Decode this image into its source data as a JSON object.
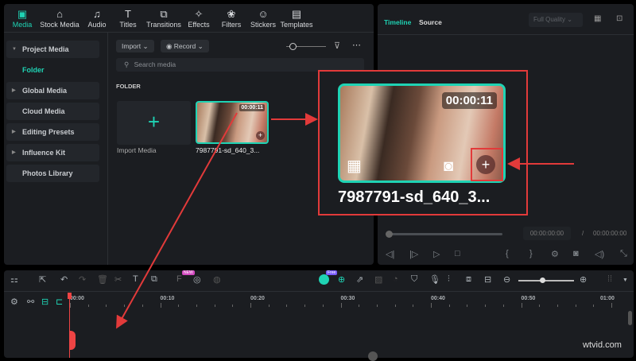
{
  "tabs": [
    {
      "label": "Media",
      "icon": "media-icon",
      "active": true
    },
    {
      "label": "Stock Media",
      "icon": "stock-media-icon"
    },
    {
      "label": "Audio",
      "icon": "music-note-icon"
    },
    {
      "label": "Titles",
      "icon": "text-t-icon"
    },
    {
      "label": "Transitions",
      "icon": "transitions-icon"
    },
    {
      "label": "Effects",
      "icon": "effects-star-icon"
    },
    {
      "label": "Filters",
      "icon": "filters-icon"
    },
    {
      "label": "Stickers",
      "icon": "stickers-icon"
    },
    {
      "label": "Templates",
      "icon": "templates-icon"
    }
  ],
  "sidebar": {
    "items": [
      {
        "label": "Project Media",
        "expanded": true
      },
      {
        "label": "Folder",
        "selected": true
      },
      {
        "label": "Global Media"
      },
      {
        "label": "Cloud Media"
      },
      {
        "label": "Editing Presets"
      },
      {
        "label": "Influence Kit"
      },
      {
        "label": "Photos Library"
      }
    ]
  },
  "media": {
    "import_label": "Import",
    "record_label": "Record",
    "search_placeholder": "Search media",
    "folder_heading": "FOLDER",
    "import_media_label": "Import Media",
    "clip": {
      "name": "7987791-sd_640_3...",
      "duration": "00:00:11"
    }
  },
  "player": {
    "tab_timeline": "Timeline",
    "tab_source": "Source",
    "quality": "Full Quality",
    "current_time": "00:00:00:00",
    "separator": "/",
    "total_time": "00:00:00:00",
    "progress": 0
  },
  "timeline": {
    "ruler": [
      "00:00",
      "00:10",
      "00:20",
      "00:30",
      "00:40",
      "00:50",
      "01:00"
    ],
    "badge_new": "NEW",
    "badge_free": "Free"
  },
  "accent": "#1fd3b4",
  "annotation_color": "#e23a3a",
  "watermark": "wtvid.com"
}
